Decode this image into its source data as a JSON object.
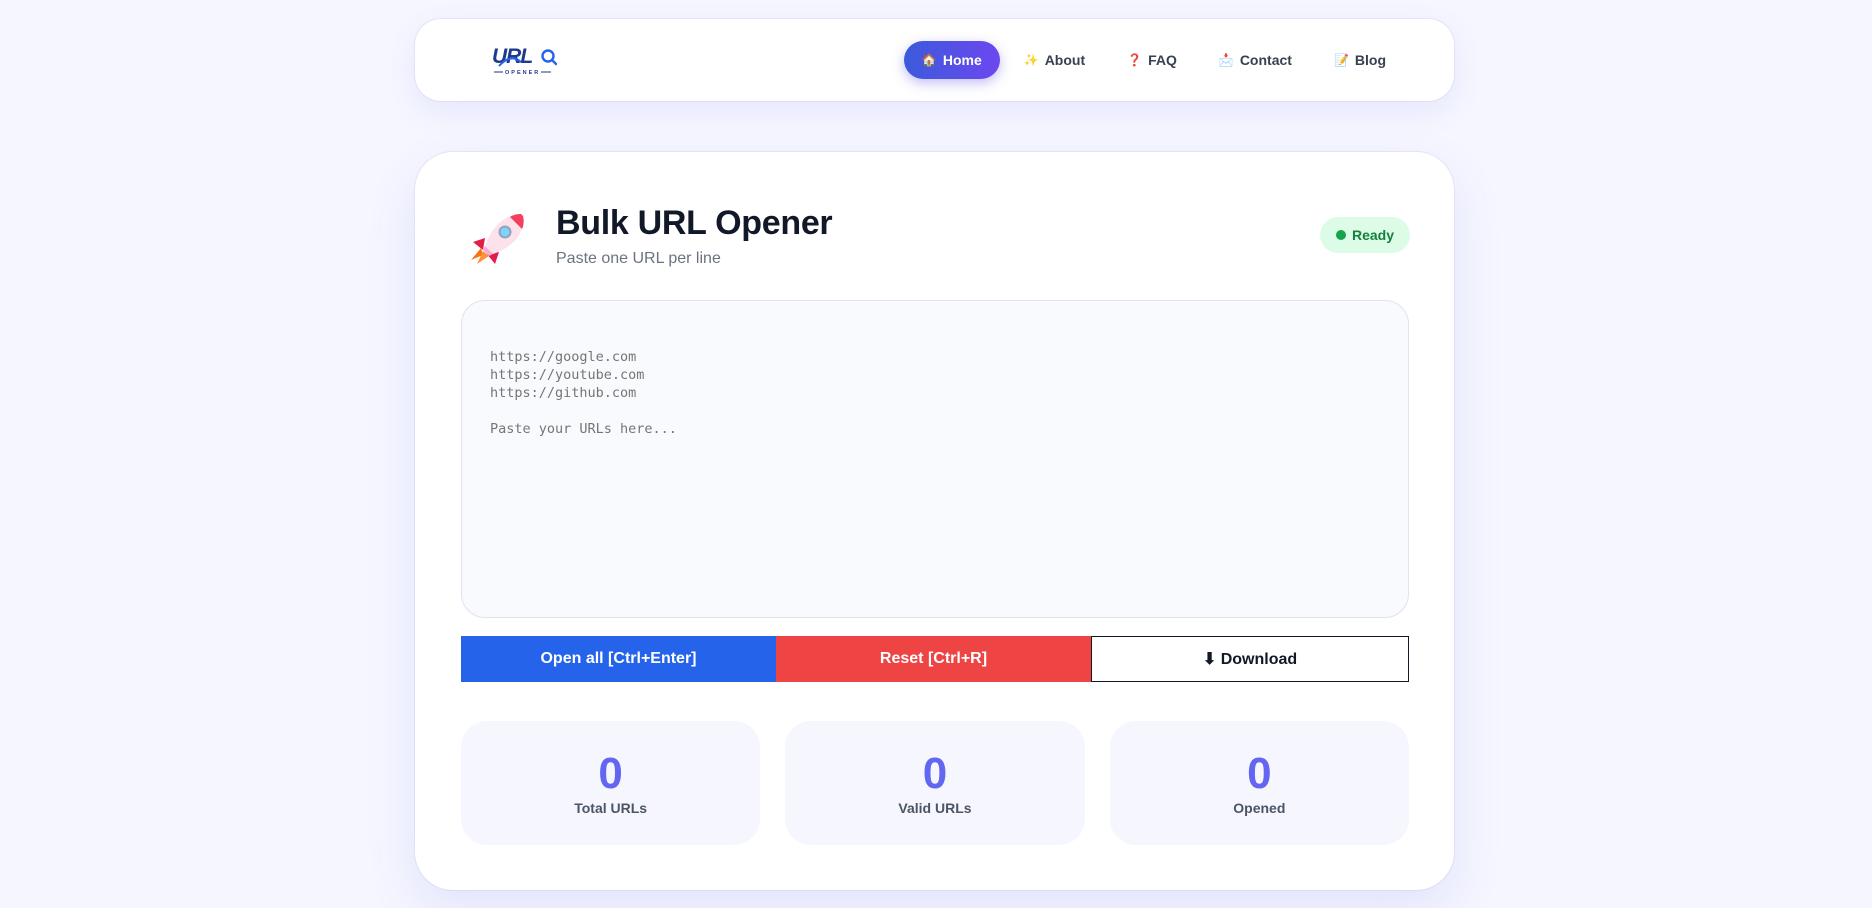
{
  "nav": {
    "items": [
      {
        "emoji": "🏠",
        "label": "Home",
        "icon": "home-icon",
        "active": true
      },
      {
        "emoji": "✨",
        "label": "About",
        "icon": "sparkles-icon",
        "active": false
      },
      {
        "emoji": "❓",
        "label": "FAQ",
        "icon": "question-icon",
        "active": false
      },
      {
        "emoji": "📩",
        "label": "Contact",
        "icon": "envelope-icon",
        "active": false
      },
      {
        "emoji": "📝",
        "label": "Blog",
        "icon": "memo-icon",
        "active": false
      }
    ]
  },
  "logo": {
    "text": "URL",
    "subtext": "OPENER"
  },
  "header": {
    "title": "Bulk URL Opener",
    "subtitle": "Paste one URL per line",
    "status": "Ready"
  },
  "input": {
    "value": "",
    "placeholder": "https://google.com\nhttps://youtube.com\nhttps://github.com\n\nPaste your URLs here..."
  },
  "buttons": {
    "open_all": "Open all [Ctrl+Enter]",
    "reset": "Reset [Ctrl+R]",
    "download": "⬇ Download"
  },
  "stats": [
    {
      "value": "0",
      "label": "Total URLs"
    },
    {
      "value": "0",
      "label": "Valid URLs"
    },
    {
      "value": "0",
      "label": "Opened"
    }
  ],
  "colors": {
    "primary": "#2563eb",
    "danger": "#ef4444",
    "accent": "#6366f1",
    "status_bg": "#dcfce7",
    "status_text": "#15803d"
  }
}
